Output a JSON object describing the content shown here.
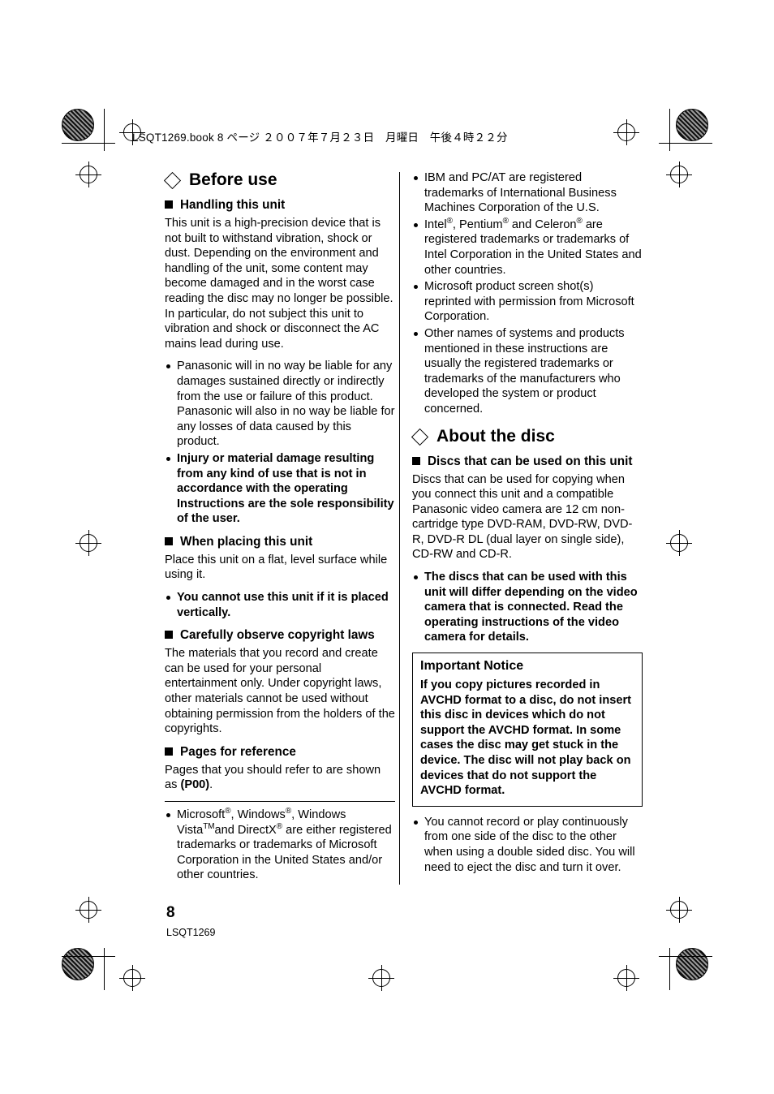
{
  "header": {
    "file_line": "LSQT1269.book  8 ページ  ２００７年７月２３日　月曜日　午後４時２２分"
  },
  "left_column": {
    "chapter_title": "Before use",
    "sections": [
      {
        "heading": "Handling this unit",
        "paragraph": "This unit is a high-precision device that is not built to withstand vibration, shock or dust. Depending on the environment and handling of the unit, some content may become damaged and in the worst case reading the disc may no longer be possible. In particular, do not subject this unit to vibration and shock or disconnect the AC mains lead during use.",
        "bullets": [
          {
            "text": "Panasonic will in no way be liable for any damages sustained directly or indirectly from the use or failure of this product. Panasonic will also in no way be liable for any losses of data caused by this product.",
            "bold": false
          },
          {
            "text": "Injury or material damage resulting from any kind of use that is not in accordance with the operating Instructions are the sole responsibility of the user.",
            "bold": true
          }
        ]
      },
      {
        "heading": "When placing this unit",
        "paragraph": "Place this unit on a flat, level surface while using it.",
        "bullets": [
          {
            "text": "You cannot use this unit if it is placed vertically.",
            "bold": true
          }
        ]
      },
      {
        "heading": "Carefully observe copyright laws",
        "paragraph": "The materials that you record and create can be used for your personal entertainment only. Under copyright laws, other materials cannot be used without obtaining permission from the holders of the copyrights.",
        "bullets": []
      },
      {
        "heading": "Pages for reference",
        "paragraph_prefix": "Pages that you should refer to are shown as ",
        "paragraph_bold": "(P00)",
        "paragraph_suffix": "."
      }
    ],
    "trademark_bullet": {
      "line1_a": "Microsoft",
      "line1_sup1": "®",
      "line1_b": ", Windows",
      "line1_sup2": "®",
      "line1_c": ", Windows Vista",
      "line1_sup3": "TM",
      "line2_a": "and DirectX",
      "line2_sup": "®",
      "line2_b": " are either registered trademarks or trademarks of Microsoft Corporation in the United States and/or other countries."
    }
  },
  "right_column": {
    "top_bullets": [
      "IBM and PC/AT are registered trademarks of International Business Machines Corporation of the U.S.",
      "Microsoft product screen shot(s) reprinted with permission from Microsoft Corporation.",
      "Other names of systems and products mentioned in these instructions are usually the registered trademarks or trademarks of the manufacturers who developed the system or product concerned."
    ],
    "intel_bullet": {
      "a": "Intel",
      "sup1": "®",
      "b": ", Pentium",
      "sup2": "®",
      "c": " and Celeron",
      "sup3": "®",
      "d": " are registered trademarks or trademarks of Intel Corporation in the United States and other countries."
    },
    "chapter_title": "About the disc",
    "section_heading": "Discs that can be used on this unit",
    "section_paragraph": "Discs that can be used for copying when you connect this unit and a compatible Panasonic video camera are 12 cm non-cartridge type DVD-RAM, DVD-RW, DVD-R, DVD-R DL (dual layer on single side), CD-RW and CD-R.",
    "section_bullet_bold": "The discs that can be used with this unit will differ depending on the video camera that is connected. Read the operating instructions of the video camera for details.",
    "notice": {
      "title": "Important Notice",
      "text": "If you copy pictures recorded in AVCHD format to a disc, do not insert this disc in devices which do not support the AVCHD format. In some cases the disc may get stuck in the device. The disc will not play back on devices that do not support the AVCHD format."
    },
    "final_bullet": "You cannot record or play continuously from one side of the disc to the other when using a double sided disc. You will need to eject the disc and turn it over."
  },
  "footer": {
    "page_number": "8",
    "code": "LSQT1269"
  }
}
